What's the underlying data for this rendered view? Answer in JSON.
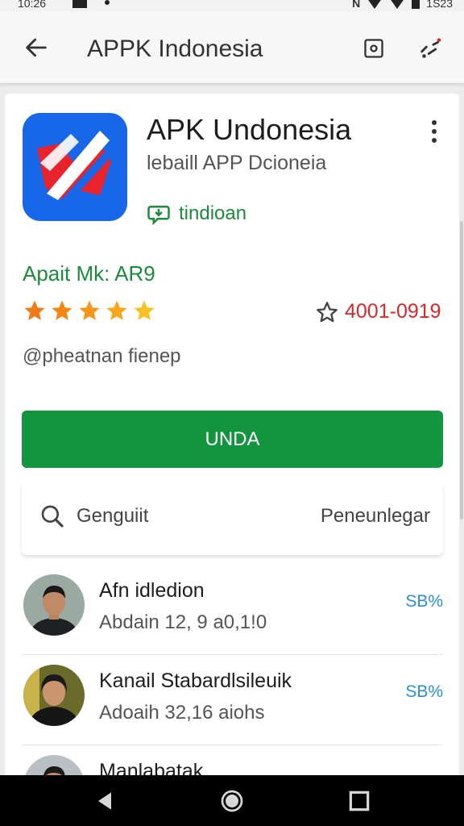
{
  "status_bar": {
    "time": "10:26",
    "right_time": "1S23"
  },
  "app_bar": {
    "title": "APPK Indonesia"
  },
  "app": {
    "name": "APK Undonesia",
    "developer": "lebaill APP Dcioneia",
    "install_tag": "tindioan",
    "category": "Apait Mk: AR9",
    "stars": 5,
    "rating_count": "4001-0919",
    "handle": "@pheatnan fienep",
    "primary_button": "UNDA",
    "accent": "#14943f",
    "icon_color": "#1767e8"
  },
  "search": {
    "placeholder": "Genguiit",
    "sort_label": "Peneunlegar"
  },
  "list": [
    {
      "title": "Afn idledion",
      "subtitle": "Abdain 12, 9 a0,1!0",
      "percent": "SB%"
    },
    {
      "title": "Kanail Stabardlsileuik",
      "subtitle": "Adoaih 32,16 aiohs",
      "percent": "SB%"
    },
    {
      "title": "Manlabatak",
      "subtitle": "",
      "percent": ""
    }
  ]
}
